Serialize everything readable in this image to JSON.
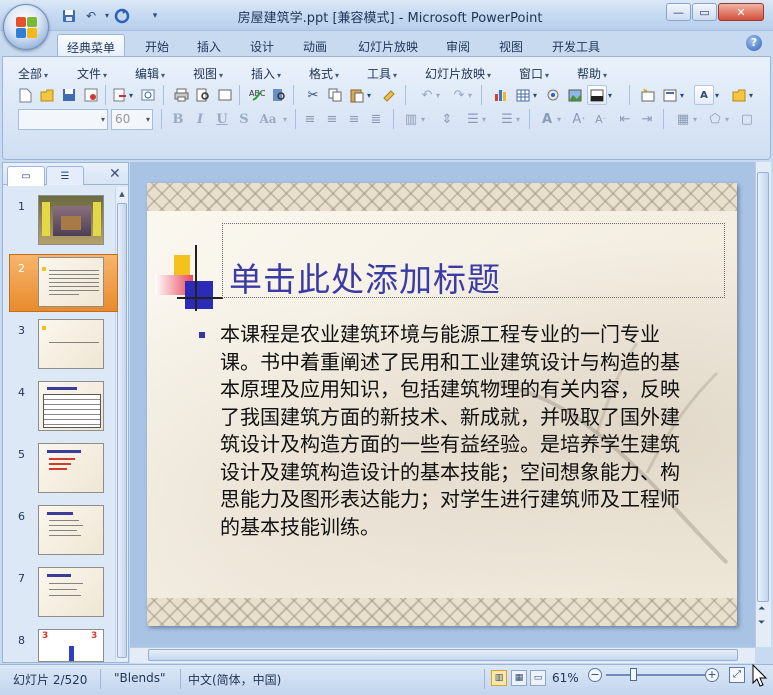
{
  "window": {
    "title": "房屋建筑学.ppt [兼容模式] - Microsoft PowerPoint"
  },
  "qat": {
    "save_icon": "save-icon",
    "undo_icon": "undo-icon",
    "redo_icon": "redo-icon"
  },
  "ribbon_tabs": [
    {
      "label": "经典菜单",
      "active": true
    },
    {
      "label": "开始"
    },
    {
      "label": "插入"
    },
    {
      "label": "设计"
    },
    {
      "label": "动画"
    },
    {
      "label": "幻灯片放映"
    },
    {
      "label": "审阅"
    },
    {
      "label": "视图"
    },
    {
      "label": "开发工具"
    }
  ],
  "menu": [
    {
      "label": "全部"
    },
    {
      "label": "文件"
    },
    {
      "label": "编辑"
    },
    {
      "label": "视图"
    },
    {
      "label": "插入"
    },
    {
      "label": "格式"
    },
    {
      "label": "工具"
    },
    {
      "label": "幻灯片放映"
    },
    {
      "label": "窗口"
    },
    {
      "label": "帮助"
    }
  ],
  "toolbar": {
    "font_name": "",
    "font_size": "60",
    "bold": "B",
    "italic": "I",
    "underline": "U",
    "strike": "S",
    "case": "Aa"
  },
  "slides": [
    {
      "number": "1"
    },
    {
      "number": "2",
      "selected": true
    },
    {
      "number": "3"
    },
    {
      "number": "4"
    },
    {
      "number": "5"
    },
    {
      "number": "6"
    },
    {
      "number": "7"
    },
    {
      "number": "8"
    }
  ],
  "thumb8_labels": {
    "left": "3",
    "right": "3"
  },
  "slide": {
    "title": "单击此处添加标题",
    "body": "本课程是农业建筑环境与能源工程专业的一门专业课。书中着重阐述了民用和工业建筑设计与构造的基本原理及应用知识，包括建筑物理的有关内容，反映了我国建筑方面的新技术、新成就，并吸取了国外建筑设计及构造方面的一些有益经验。是培养学生建筑设计及建筑构造设计的基本技能；空间想象能力、构思能力及图形表达能力；对学生进行建筑师及工程师的基本技能训练。"
  },
  "status": {
    "slide_info": "幻灯片 2/520",
    "theme": "\"Blends\"",
    "language": "中文(简体，中国)",
    "zoom": "61%"
  },
  "zoom_level": 0.61,
  "colors": {
    "title_blue": "#3b3ba6",
    "selected_thumb": "#e88b2c",
    "ribbon_bg": "#dae6f6"
  }
}
